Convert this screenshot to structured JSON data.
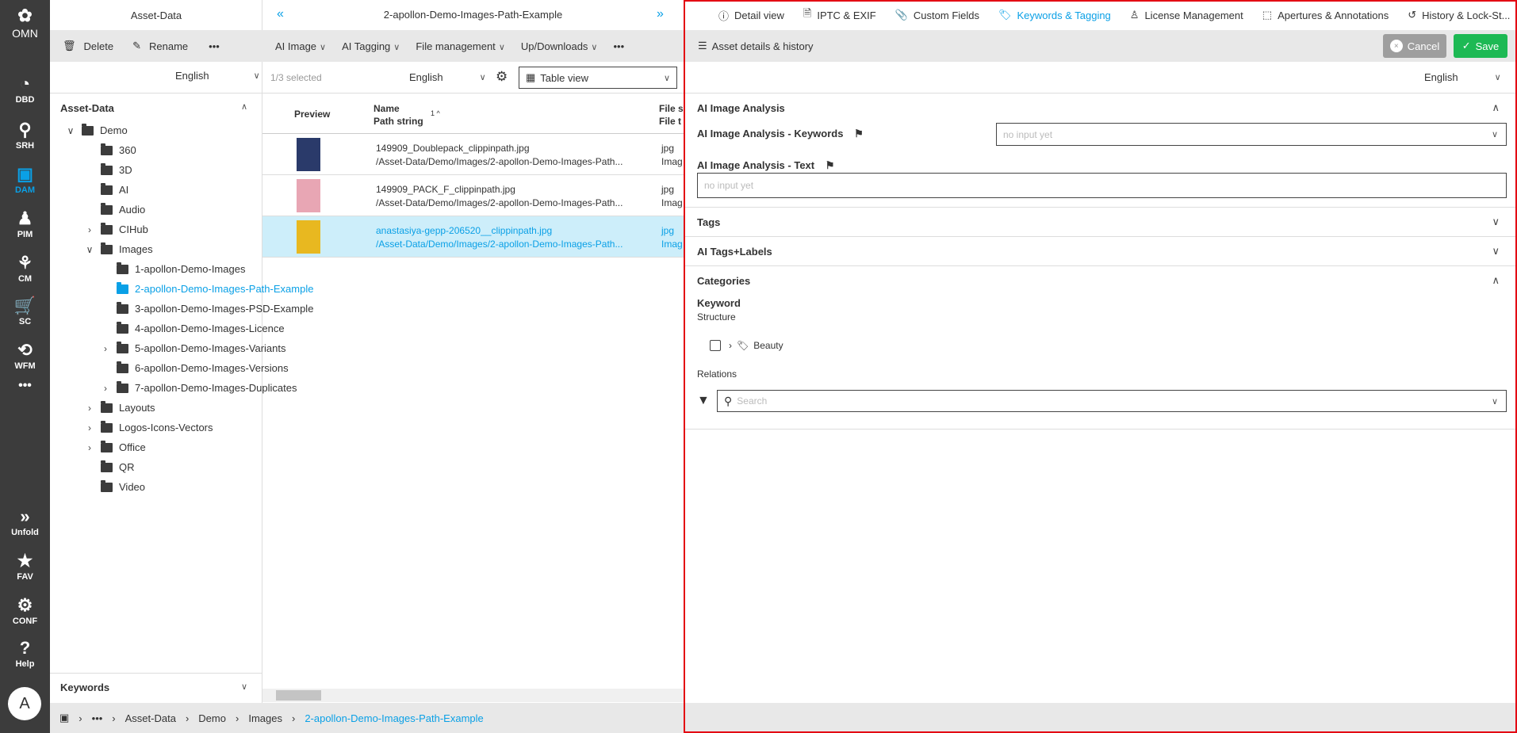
{
  "rail": {
    "logo": "OMN",
    "items": [
      {
        "label": "DBD",
        "icon": "dashboard-icon"
      },
      {
        "label": "SRH",
        "icon": "search-icon"
      },
      {
        "label": "DAM",
        "icon": "image-gallery-icon",
        "active": true
      },
      {
        "label": "PIM",
        "icon": "product-icon"
      },
      {
        "label": "CM",
        "icon": "share-icon"
      },
      {
        "label": "SC",
        "icon": "cart-icon"
      },
      {
        "label": "WFM",
        "icon": "workflow-icon"
      },
      {
        "label": "•••",
        "icon": "more-icon"
      }
    ],
    "bottom": [
      {
        "label": "Unfold",
        "icon": "double-chevron-right-icon"
      },
      {
        "label": "FAV",
        "icon": "star-icon"
      },
      {
        "label": "CONF",
        "icon": "gear-icon"
      },
      {
        "label": "Help",
        "icon": "question-icon"
      }
    ],
    "avatar": "A"
  },
  "folders": {
    "title": "Asset-Data",
    "delete": "Delete",
    "rename": "Rename",
    "more": "•••",
    "language": "English",
    "root": "Asset-Data",
    "tree": [
      {
        "label": "Demo",
        "level": 0,
        "arrow": "open",
        "open": true
      },
      {
        "label": "360",
        "level": 1
      },
      {
        "label": "3D",
        "level": 1
      },
      {
        "label": "AI",
        "level": 1
      },
      {
        "label": "Audio",
        "level": 1
      },
      {
        "label": "CIHub",
        "level": 1,
        "arrow": "closed"
      },
      {
        "label": "Images",
        "level": 1,
        "arrow": "open",
        "open": true
      },
      {
        "label": "1-apollon-Demo-Images",
        "level": 2
      },
      {
        "label": "2-apollon-Demo-Images-Path-Example",
        "level": 2,
        "selected": true
      },
      {
        "label": "3-apollon-Demo-Images-PSD-Example",
        "level": 2
      },
      {
        "label": "4-apollon-Demo-Images-Licence",
        "level": 2
      },
      {
        "label": "5-apollon-Demo-Images-Variants",
        "level": 2,
        "arrow": "closed"
      },
      {
        "label": "6-apollon-Demo-Images-Versions",
        "level": 2
      },
      {
        "label": "7-apollon-Demo-Images-Duplicates",
        "level": 2,
        "arrow": "closed"
      },
      {
        "label": "Layouts",
        "level": 1,
        "arrow": "closed"
      },
      {
        "label": "Logos-Icons-Vectors",
        "level": 1,
        "arrow": "closed"
      },
      {
        "label": "Office",
        "level": 1,
        "arrow": "closed"
      },
      {
        "label": "QR",
        "level": 1
      },
      {
        "label": "Video",
        "level": 1
      }
    ],
    "keywords": "Keywords"
  },
  "list": {
    "title": "2-apollon-Demo-Images-Path-Example",
    "menus": [
      "AI Image",
      "AI Tagging",
      "File management",
      "Up/Downloads"
    ],
    "more": "•••",
    "selected": "1/3 selected",
    "language": "English",
    "view": "Table view",
    "columns": {
      "preview": "Preview",
      "name": "Name",
      "path": "Path string",
      "sort": "1 ^",
      "filesize": "File s",
      "filetype": "File t"
    },
    "rows": [
      {
        "name": "149909_Doublepack_clippinpath.jpg",
        "path": "/Asset-Data/Demo/Images/2-apollon-Demo-Images-Path...",
        "ext": "jpg",
        "type": "Imag",
        "thumb": "#2a3a6a"
      },
      {
        "name": "149909_PACK_F_clippinpath.jpg",
        "path": "/Asset-Data/Demo/Images/2-apollon-Demo-Images-Path...",
        "ext": "jpg",
        "type": "Imag",
        "thumb": "#e8a6b4"
      },
      {
        "name": "anastasiya-gepp-206520__clippinpath.jpg",
        "path": "/Asset-Data/Demo/Images/2-apollon-Demo-Images-Path...",
        "ext": "jpg",
        "type": "Imag",
        "thumb": "#e8b820",
        "selected": true
      }
    ]
  },
  "breadcrumb": [
    "•••",
    "Asset-Data",
    "Demo",
    "Images",
    "2-apollon-Demo-Images-Path-Example"
  ],
  "detail": {
    "tabs": [
      {
        "label": "Detail view",
        "icon": "info-icon"
      },
      {
        "label": "IPTC & EXIF",
        "icon": "file-icon"
      },
      {
        "label": "Custom Fields",
        "icon": "paperclip-icon"
      },
      {
        "label": "Keywords & Tagging",
        "icon": "tag-icon",
        "active": true
      },
      {
        "label": "License Management",
        "icon": "stamp-icon"
      },
      {
        "label": "Apertures & Annotations",
        "icon": "selection-icon"
      },
      {
        "label": "History & Lock-St...",
        "icon": "history-icon"
      }
    ],
    "toolbar": {
      "title": "Asset details & history",
      "cancel": "Cancel",
      "save": "Save"
    },
    "language": "English",
    "ai": {
      "title": "AI Image Analysis",
      "keywords_label": "AI Image Analysis - Keywords",
      "keywords_placeholder": "no input yet",
      "text_label": "AI Image Analysis - Text",
      "text_placeholder": "no input yet"
    },
    "tags": "Tags",
    "ai_tags": "AI Tags+Labels",
    "categories": {
      "title": "Categories",
      "keyword": "Keyword",
      "structure": "Structure",
      "item": "Beauty",
      "relations": "Relations",
      "search_placeholder": "Search"
    }
  },
  "colors": {
    "accent": "#0aa0e6",
    "save": "#1db954",
    "cancel": "#9e9e9e",
    "rail": "#3c3c3c",
    "highlight": "#e30613"
  }
}
